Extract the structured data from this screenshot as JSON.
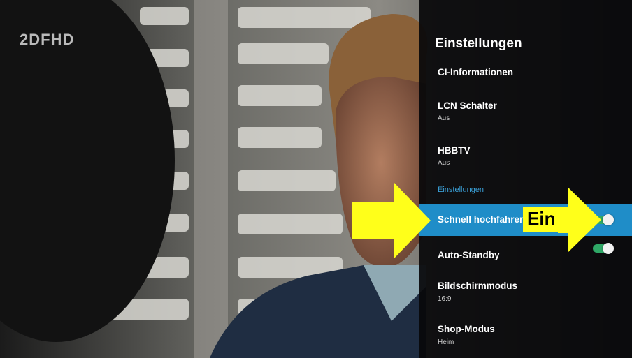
{
  "channel_logo": "2DFHD",
  "settings_panel": {
    "title": "Einstellungen",
    "items": [
      {
        "label": "CI-Informationen",
        "value": ""
      },
      {
        "label": "LCN Schalter",
        "value": "Aus"
      },
      {
        "label": "HBBTV",
        "value": "Aus"
      }
    ],
    "section_header": "Einstellungen",
    "toggles": [
      {
        "label": "Schnell hochfahren",
        "state": "on",
        "selected": true
      },
      {
        "label": "Auto-Standby",
        "state": "on",
        "selected": false
      }
    ],
    "more_items": [
      {
        "label": "Bildschirmmodus",
        "value": "16:9"
      },
      {
        "label": "Shop-Modus",
        "value": "Heim"
      }
    ]
  },
  "annotation": {
    "ein_label": "Ein",
    "arrow_color": "#ffff1a"
  },
  "colors": {
    "highlight": "#1f8dc8",
    "toggle_on": "#2fa866",
    "section_header": "#3aa0d8"
  }
}
